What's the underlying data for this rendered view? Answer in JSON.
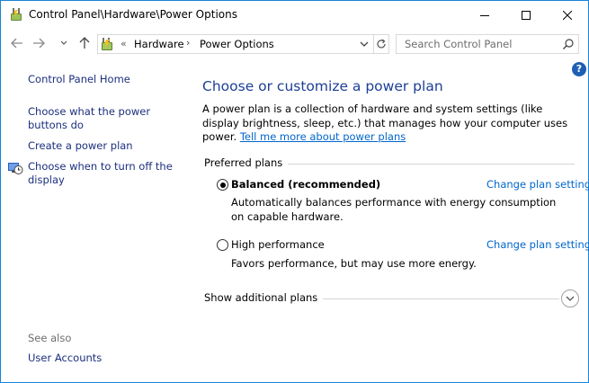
{
  "window": {
    "title": "Control Panel\\Hardware\\Power Options"
  },
  "address_bar": {
    "overflow_chevron": "«",
    "breadcrumbs": [
      "Hardware",
      "Power Options"
    ],
    "separator": "›"
  },
  "search": {
    "placeholder": "Search Control Panel",
    "value": ""
  },
  "help": {
    "label": "?"
  },
  "sidebar": {
    "home": "Control Panel Home",
    "tasks": [
      "Choose what the power buttons do",
      "Create a power plan",
      "Choose when to turn off the display"
    ],
    "see_also_label": "See also",
    "see_also": [
      "User Accounts"
    ]
  },
  "main": {
    "heading": "Choose or customize a power plan",
    "description": "A power plan is a collection of hardware and system settings (like display brightness, sleep, etc.) that manages how your computer uses power.",
    "description_link": "Tell me more about power plans",
    "preferred_plans_label": "Preferred plans",
    "plans": [
      {
        "name": "Balanced (recommended)",
        "selected": true,
        "description": "Automatically balances performance with energy consumption on capable hardware.",
        "link": "Change plan settings"
      },
      {
        "name": "High performance",
        "selected": false,
        "description": "Favors performance, but may use more energy.",
        "link": "Change plan settings"
      }
    ],
    "show_additional": "Show additional plans"
  },
  "colors": {
    "accent_border": "#1883d7",
    "heading": "#1c3f94",
    "link": "#0066cc",
    "sidebar_link": "#1c2f7e"
  },
  "icons": {
    "app": "power-options-icon",
    "display_task": "display-clock-icon",
    "search": "search-icon",
    "refresh": "refresh-icon",
    "expand": "chevron-down-icon"
  }
}
